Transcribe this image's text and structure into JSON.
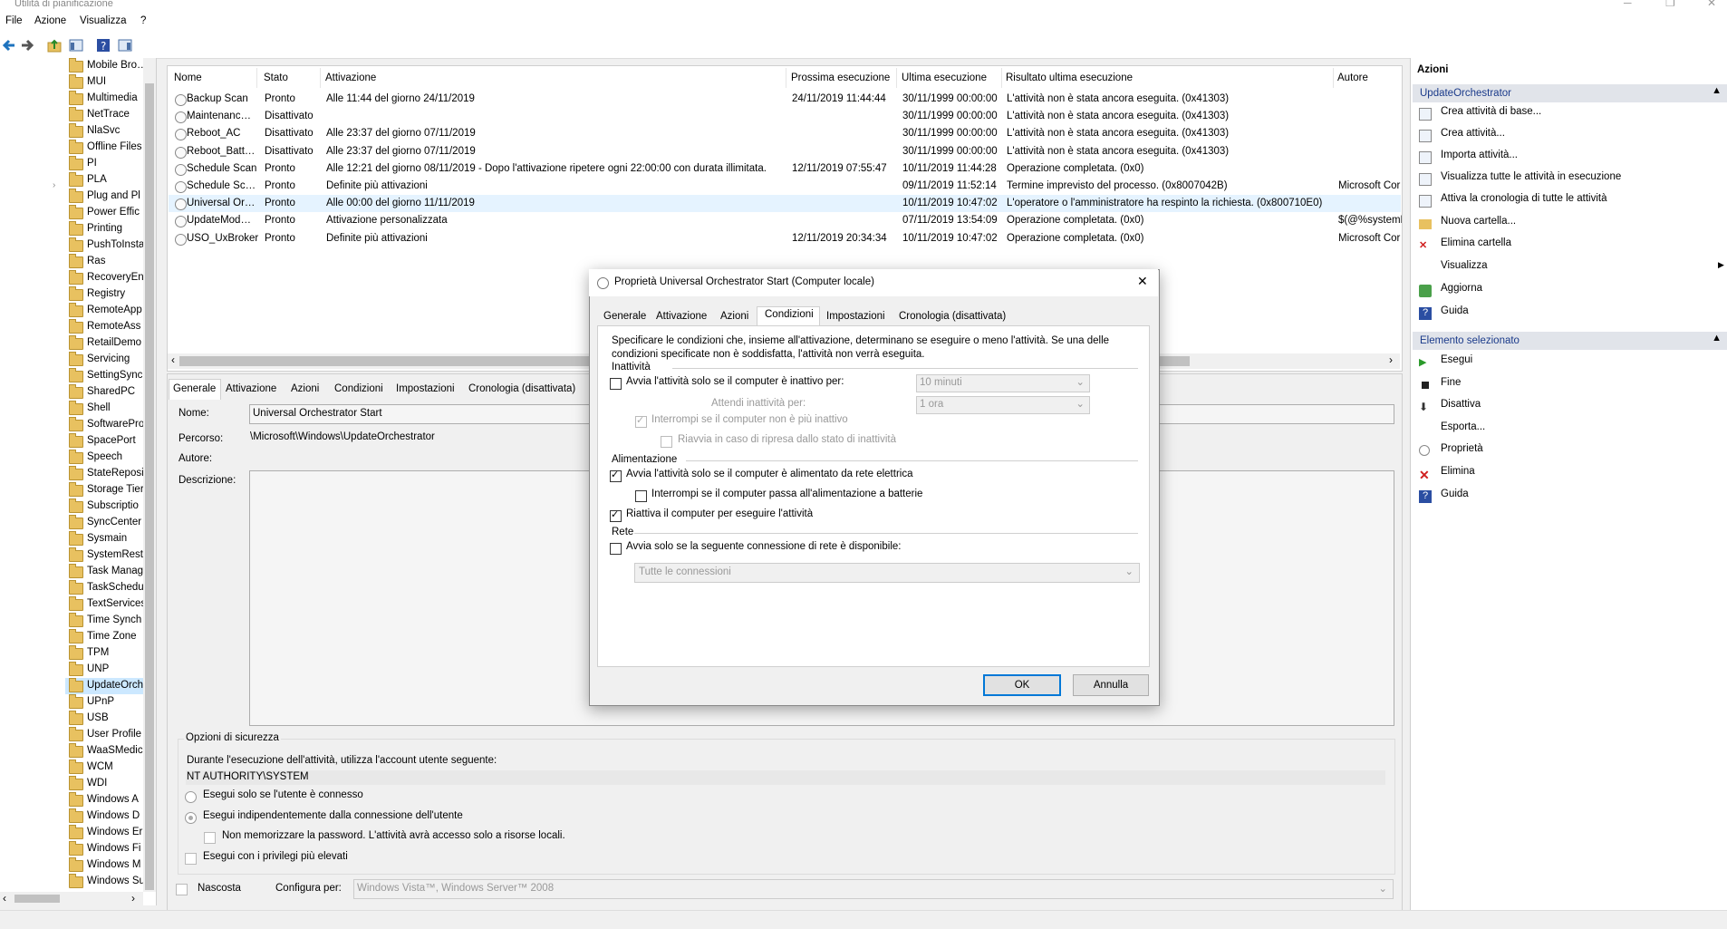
{
  "window": {
    "title": "Utilità di pianificazione"
  },
  "menu": [
    "File",
    "Azione",
    "Visualizza",
    "?"
  ],
  "tree": {
    "items": [
      "Mobile Bro…",
      "MUI",
      "Multimedia",
      "NetTrace",
      "NlaSvc",
      "Offline Files",
      "PI",
      "PLA",
      "Plug and Pl",
      "Power Effic",
      "Printing",
      "PushToInsta",
      "Ras",
      "RecoveryEn",
      "Registry",
      "RemoteApp",
      "RemoteAss",
      "RetailDemo",
      "Servicing",
      "SettingSync",
      "SharedPC",
      "Shell",
      "SoftwarePro",
      "SpacePort",
      "Speech",
      "StateReposi",
      "Storage Tier",
      "Subscriptio",
      "SyncCenter",
      "Sysmain",
      "SystemRest",
      "Task Manag",
      "TaskSchedu",
      "TextServices",
      "Time Synch",
      "Time Zone",
      "TPM",
      "UNP",
      "UpdateOrch",
      "UPnP",
      "USB",
      "User Profile",
      "WaaSMedic",
      "WCM",
      "WDI",
      "Windows A",
      "Windows D",
      "Windows Er",
      "Windows Fi",
      "Windows M",
      "Windows Su"
    ],
    "selected_index": 38
  },
  "tasks": {
    "columns": [
      "Nome",
      "Stato",
      "Attivazione",
      "Prossima esecuzione",
      "Ultima esecuzione",
      "Risultato ultima esecuzione",
      "Autore"
    ],
    "rows": [
      [
        "Backup Scan",
        "Pronto",
        "Alle 11:44 del giorno 24/11/2019",
        "24/11/2019 11:44:44",
        "30/11/1999 00:00:00",
        "L'attività non è stata ancora eseguita. (0x41303)",
        ""
      ],
      [
        "Maintenanc…",
        "Disattivato",
        "",
        "",
        "30/11/1999 00:00:00",
        "L'attività non è stata ancora eseguita. (0x41303)",
        ""
      ],
      [
        "Reboot_AC",
        "Disattivato",
        "Alle 23:37 del giorno 07/11/2019",
        "",
        "30/11/1999 00:00:00",
        "L'attività non è stata ancora eseguita. (0x41303)",
        ""
      ],
      [
        "Reboot_Batt…",
        "Disattivato",
        "Alle 23:37 del giorno 07/11/2019",
        "",
        "30/11/1999 00:00:00",
        "L'attività non è stata ancora eseguita. (0x41303)",
        ""
      ],
      [
        "Schedule Scan",
        "Pronto",
        "Alle 12:21 del giorno 08/11/2019 - Dopo l'attivazione ripetere ogni 22:00:00 con durata illimitata.",
        "12/11/2019 07:55:47",
        "10/11/2019 11:44:28",
        "Operazione completata. (0x0)",
        ""
      ],
      [
        "Schedule Sc…",
        "Pronto",
        "Definite più attivazioni",
        "",
        "09/11/2019 11:52:14",
        "Termine imprevisto del processo. (0x8007042B)",
        "Microsoft Cor"
      ],
      [
        "Universal Or…",
        "Pronto",
        "Alle 00:00 del giorno 11/11/2019",
        "",
        "10/11/2019 10:47:02",
        "L'operatore o l'amministratore ha respinto la richiesta. (0x800710E0)",
        ""
      ],
      [
        "UpdateMod…",
        "Pronto",
        "Attivazione personalizzata",
        "",
        "07/11/2019 13:54:09",
        "Operazione completata. (0x0)",
        "$(@%systemR"
      ],
      [
        "USO_UxBroker",
        "Pronto",
        "Definite più attivazioni",
        "12/11/2019 20:34:34",
        "10/11/2019 10:47:02",
        "Operazione completata. (0x0)",
        "Microsoft Cor"
      ]
    ],
    "selected_index": 6
  },
  "details": {
    "tabs": [
      "Generale",
      "Attivazione",
      "Azioni",
      "Condizioni",
      "Impostazioni",
      "Cronologia (disattivata)"
    ],
    "name_label": "Nome:",
    "name_value": "Universal Orchestrator Start",
    "path_label": "Percorso:",
    "path_value": "\\Microsoft\\Windows\\UpdateOrchestrator",
    "author_label": "Autore:",
    "desc_label": "Descrizione:",
    "security_group": "Opzioni di sicurezza",
    "account_text": "Durante l'esecuzione dell'attività, utilizza l'account utente seguente:",
    "account_value": "NT AUTHORITY\\SYSTEM",
    "radio1": "Esegui solo se l'utente è connesso",
    "radio2": "Esegui indipendentemente dalla connessione dell'utente",
    "nopwd": "Non memorizzare la password. L'attività avrà accesso solo a risorse locali.",
    "highest": "Esegui con i privilegi più elevati",
    "hidden": "Nascosta",
    "config_label": "Configura per:",
    "config_value": "Windows Vista™, Windows Server™ 2008"
  },
  "actions": {
    "header": "Azioni",
    "section1": "UpdateOrchestrator",
    "items1": [
      "Crea attività di base...",
      "Crea attività...",
      "Importa attività...",
      "Visualizza tutte le attività in esecuzione",
      "Attiva la cronologia di tutte le attività",
      "Nuova cartella...",
      "Elimina cartella",
      "Visualizza",
      "Aggiorna",
      "Guida"
    ],
    "section2": "Elemento selezionato",
    "items2": [
      "Esegui",
      "Fine",
      "Disattiva",
      "Esporta...",
      "Proprietà",
      "Elimina",
      "Guida"
    ]
  },
  "dialog": {
    "title": "Proprietà Universal Orchestrator Start (Computer locale)",
    "tabs": [
      "Generale",
      "Attivazione",
      "Azioni",
      "Condizioni",
      "Impostazioni",
      "Cronologia (disattivata)"
    ],
    "active_tab": 3,
    "intro": "Specificare le condizioni che, insieme all'attivazione, determinano se eseguire o meno l'attività. Se una delle condizioni specificate non è soddisfatta, l'attività non verrà eseguita.",
    "grp_idle": "Inattività",
    "idle_start": "Avvia l'attività solo se il computer è inattivo per:",
    "idle_start_value": "10 minuti",
    "idle_wait": "Attendi inattività per:",
    "idle_wait_value": "1 ora",
    "idle_stop": "Interrompi se il computer non è più inattivo",
    "idle_restart": "Riavvia in caso di ripresa dallo stato di inattività",
    "grp_power": "Alimentazione",
    "power_ac": "Avvia l'attività solo se il computer è alimentato da rete elettrica",
    "power_batt": "Interrompi se il computer passa all'alimentazione a batterie",
    "power_wake": "Riattiva il computer per eseguire l'attività",
    "grp_net": "Rete",
    "net_start": "Avvia solo se la seguente connessione di rete è disponibile:",
    "net_value": "Tutte le connessioni",
    "ok": "OK",
    "cancel": "Annulla"
  }
}
